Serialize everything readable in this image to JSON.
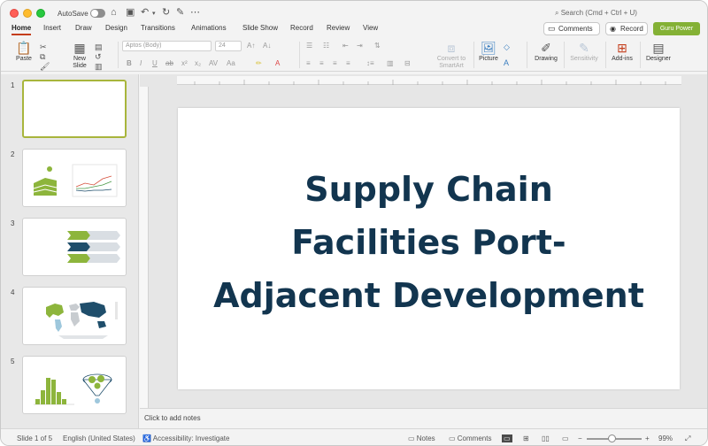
{
  "window": {
    "autosave_label": "AutoSave",
    "search_placeholder": "Search (Cmd + Ctrl + U)"
  },
  "tabs": [
    "Home",
    "Insert",
    "Draw",
    "Design",
    "Transitions",
    "Animations",
    "Slide Show",
    "Record",
    "Review",
    "View"
  ],
  "active_tab": "Home",
  "header_buttons": {
    "comments": "Comments",
    "record": "Record",
    "guru": "Guru Power"
  },
  "ribbon": {
    "paste": "Paste",
    "new_slide_line1": "New",
    "new_slide_line2": "Slide",
    "font_name": "Aptos (Body)",
    "font_size": "24",
    "convert_line1": "Convert to",
    "convert_line2": "SmartArt",
    "picture": "Picture",
    "drawing": "Drawing",
    "sensitivity": "Sensitivity",
    "addins": "Add-ins",
    "designer": "Designer"
  },
  "slides": [
    {
      "num": "1"
    },
    {
      "num": "2"
    },
    {
      "num": "3"
    },
    {
      "num": "4"
    },
    {
      "num": "5"
    }
  ],
  "slide": {
    "title_line1": "Supply Chain",
    "title_line2": "Facilities Port-",
    "title_line3": "Adjacent Development"
  },
  "notes_placeholder": "Click to add notes",
  "status": {
    "slide_count": "Slide 1 of 5",
    "language": "English (United States)",
    "accessibility": "Accessibility: Investigate",
    "notes": "Notes",
    "comments": "Comments",
    "zoom": "99%"
  },
  "colors": {
    "accent_tab": "#c43e1c",
    "guru": "#84b135",
    "title": "#12354f",
    "thumb_green": "#8db53c",
    "thumb_navy": "#1f4e6b"
  }
}
